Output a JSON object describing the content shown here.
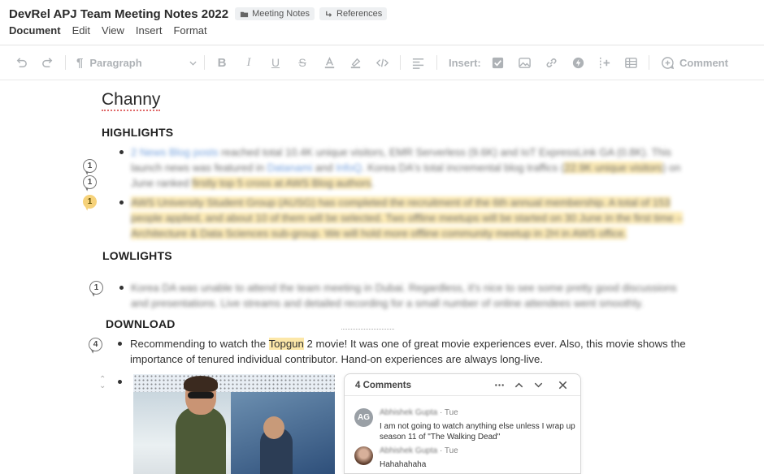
{
  "header": {
    "title": "DevRel APJ Team Meeting Notes 2022",
    "chips": [
      {
        "label": "Meeting Notes",
        "icon": "folder-icon"
      },
      {
        "label": "References",
        "icon": "reference-arrow-icon"
      }
    ],
    "menu": [
      "Document",
      "Edit",
      "View",
      "Insert",
      "Format"
    ]
  },
  "toolbar": {
    "paragraph_style": "Paragraph",
    "insert_label": "Insert:",
    "comment_label": "Comment"
  },
  "doc": {
    "heading": "Channy",
    "sections": {
      "highlights": "HIGHLIGHTS",
      "lowlights": "LOWLIGHTS",
      "download": "DOWNLOAD"
    },
    "highlights": {
      "p1_link1": "2 News Blog posts",
      "p1_text1": " reached total 10.4K unique visitors, EMR Serverless (9.6K) and IoT ExpressLink GA (0.8K). This launch news was featured in ",
      "p1_link2": "Datanami",
      "p1_and": " and ",
      "p1_link3": "InfoQ",
      "p1_text2": ". Korea DA's total incremental blog traffics (",
      "p1_hl1": "22.9K unique visitors",
      "p1_text3": ") on June ranked ",
      "p1_hl2": "firstly top 5 cross at AWS Blog authors",
      "p1_end": ".",
      "p2": "AWS University Student Group (AUSG) has completed the recruitment of the 6th annual membership. A total of 153 people applied, and about 10 of them will be selected. Two offline meetups will be started on 30 June in the first time – Architecture & Data Sciences sub-group. We will hold more offline community meetup in 2H in AWS office."
    },
    "lowlights": {
      "p1": "Korea DA was unable to attend the team meeting in Dubai. Regardless, it's nice to see some pretty good discussions and presentations. Live streams and detailed recording for a small number of online attendees went smoothly."
    },
    "download": {
      "p1_a": "Recommending to watch the ",
      "p1_hl": "Topgun",
      "p1_b": " 2 movie! It was one of great movie experiences ever. Also, this movie shows the importance of tenured individual contributor. Hand-on experiences are always long-live."
    },
    "comment_badges": {
      "b1": "1",
      "b2": "1",
      "b3": "1",
      "b4": "1",
      "b5": "4"
    }
  },
  "comments_panel": {
    "title": "4 Comments",
    "items": [
      {
        "avatar": "AG",
        "author": "Abhishek Gupta",
        "time": "· Tue",
        "text": "I am not going to watch anything else unless I wrap up season 11 of \"The Walking Dead\""
      },
      {
        "avatar": "",
        "author": "Abhishek Gupta",
        "time": "· Tue",
        "text": "Hahahahaha"
      }
    ]
  }
}
